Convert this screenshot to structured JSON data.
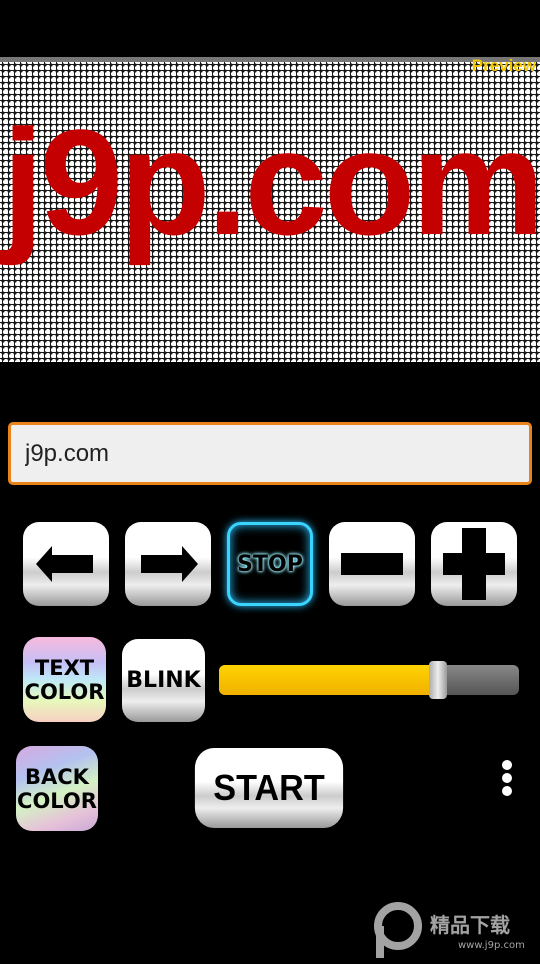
{
  "display": {
    "text": "j9p.com",
    "preview_label": "Preview",
    "text_color": "#c40000",
    "back_color": "#ffffff"
  },
  "input": {
    "value": "j9p.com"
  },
  "controls": {
    "left_icon": "arrow-left-icon",
    "right_icon": "arrow-right-icon",
    "stop_label": "STOP",
    "minus_icon": "minus-icon",
    "plus_icon": "plus-icon"
  },
  "text_color": {
    "line1": "TEXT",
    "line2": "COLOR"
  },
  "blink_label": "BLINK",
  "speed_slider": {
    "value_fraction": 0.73,
    "fill_color": "#ffc800"
  },
  "back_color": {
    "line1": "BACK",
    "line2": "COLOR"
  },
  "start_label": "START",
  "watermark": {
    "text": "精品下载",
    "url": "www.j9p.com"
  }
}
